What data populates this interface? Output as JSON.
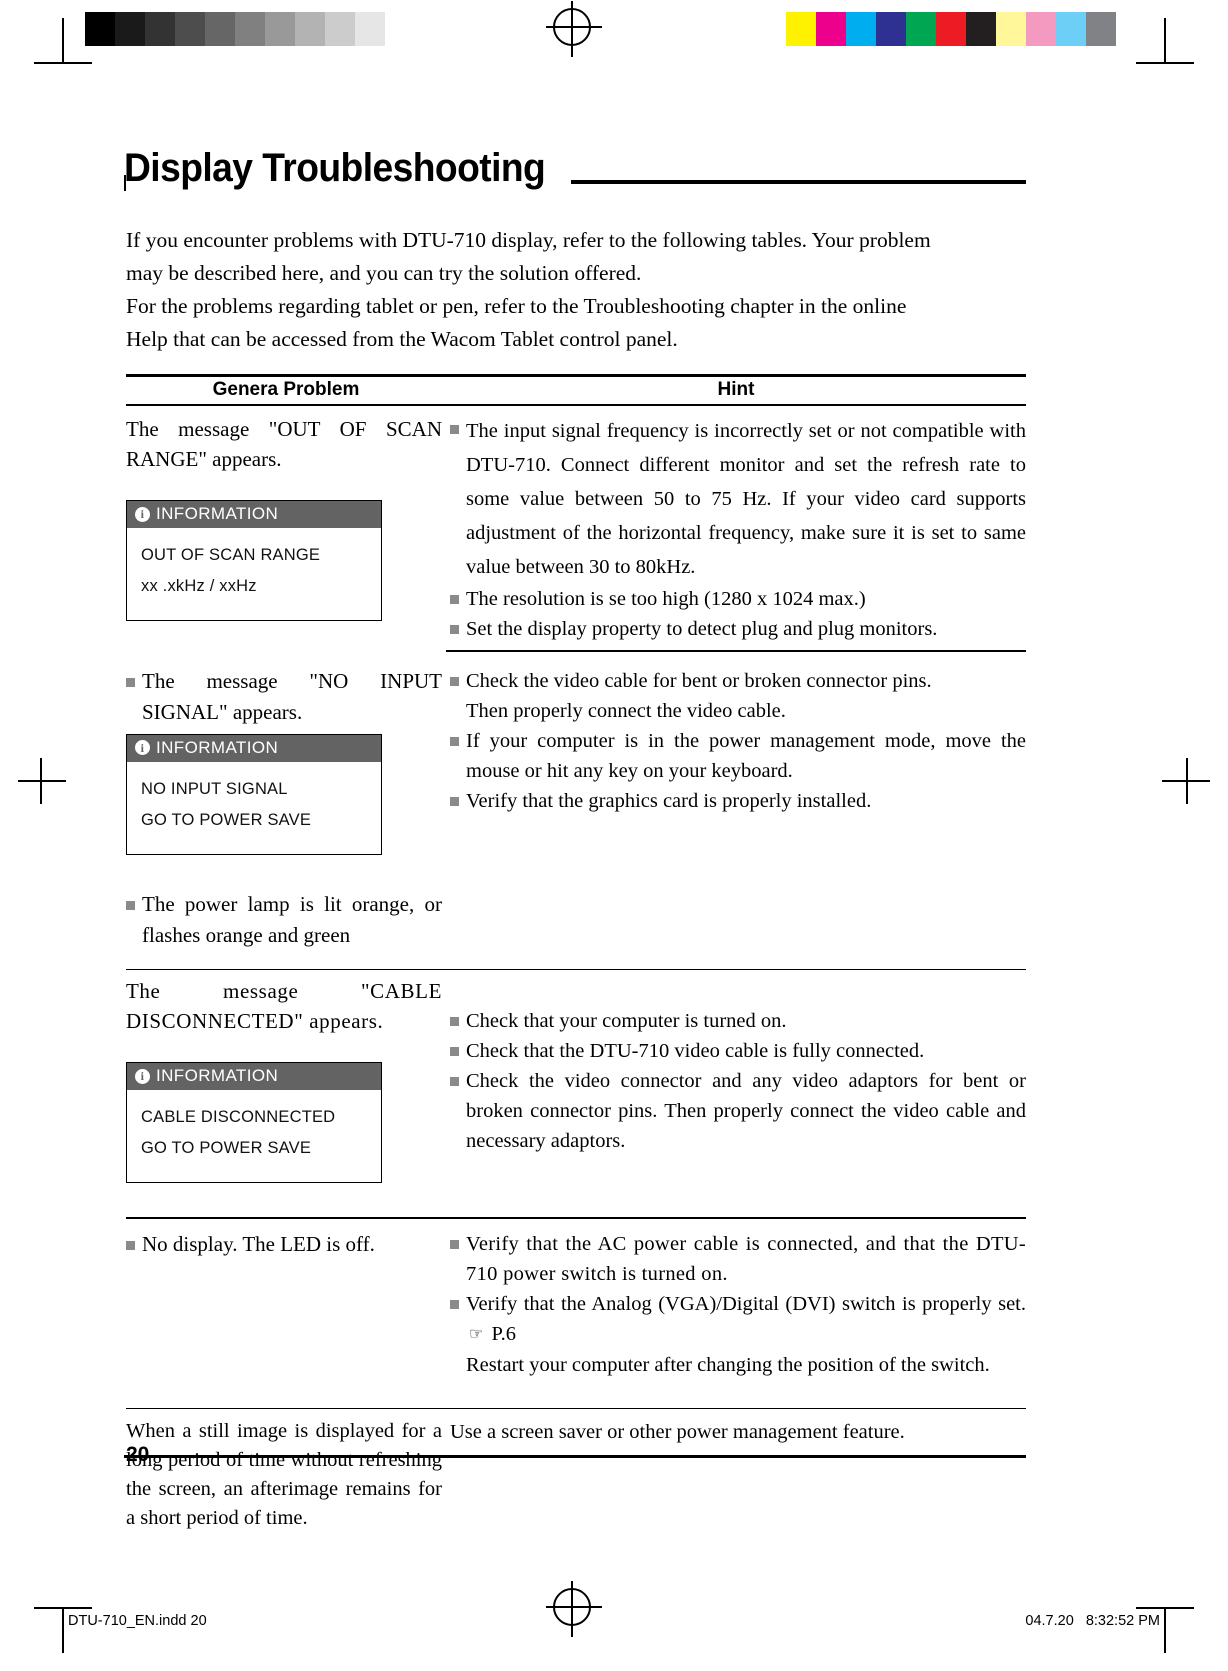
{
  "document": {
    "title": "Display Troubleshooting",
    "page_number": "20",
    "imprint_left": "DTU-710_EN.indd   20",
    "imprint_right": "04.7.20   8:32:52 PM"
  },
  "intro": {
    "line1": "If you encounter problems with DTU-710 display, refer to the following tables. Your problem",
    "line2": "may be described here, and you can try the solution offered.",
    "line3": "For the problems regarding tablet or pen, refer to the Troubleshooting chapter in the online",
    "line4": "Help that can be accessed from the Wacom Tablet control panel."
  },
  "table": {
    "headers": {
      "problem": "Genera Problem",
      "hint": "Hint"
    },
    "rows": [
      {
        "problem_text": "The message \"OUT OF SCAN RANGE\" appears.",
        "osd": {
          "header_label": "INFORMATION",
          "icon": "info-circle-icon",
          "line1": "OUT OF SCAN RANGE",
          "line2": "xx .xkHz /  xxHz"
        },
        "hints": [
          "The input signal frequency is incorrectly set or not compatible with DTU-710.  Connect different monitor and set the refresh rate to some value between 50 to 75 Hz.  If your video card supports adjustment of the horizontal frequency, make sure it is set to same value between 30 to 80kHz.",
          "The resolution is se too high (1280 x 1024 max.)",
          "Set the display property to detect plug and plug monitors."
        ]
      },
      {
        "problem_bullets": [
          "The message \"NO INPUT SIGNAL\" appears.",
          "The power lamp is lit orange, or flashes orange and green"
        ],
        "osd": {
          "header_label": "INFORMATION",
          "icon": "info-circle-icon",
          "line1": "NO INPUT SIGNAL",
          "line2": "GO TO POWER SAVE"
        },
        "hints": [
          "Check the video cable for bent or broken connector pins.",
          "Then properly connect the video cable.",
          "If your computer is in the power management mode, move the mouse or hit any key on your keyboard.",
          "Verify that the graphics card is properly installed."
        ]
      },
      {
        "problem_text": "The message \"CABLE DISCONNECTED\" appears.",
        "osd": {
          "header_label": "INFORMATION",
          "icon": "info-circle-icon",
          "line1": "CABLE DISCONNECTED",
          "line2": "GO TO POWER SAVE"
        },
        "hints": [
          "Check that your computer is turned on.",
          "Check that the DTU-710 video cable is fully connected.",
          "Check the video connector and any video adaptors for bent or broken connector pins.  Then properly connect the video cable and necessary adaptors."
        ]
      },
      {
        "problem_bullet": "No display.  The LED is off.",
        "hints": [
          "Verify that the AC power cable is connected, and that the DTU-710 power switch is turned on.",
          "Verify that the Analog (VGA)/Digital (DVI) switch is properly set.",
          "Restart your computer after changing the position of the switch."
        ],
        "page_ref": "P.6",
        "page_ref_icon": "pointing-hand-icon"
      },
      {
        "problem_text": "When a still image is displayed for a long period of time without refreshing the screen, an afterimage remains for a short period of time.",
        "hint_plain": "Use a screen saver or other power management feature."
      }
    ]
  },
  "print_marks": {
    "gray_bar": [
      "#000000",
      "#1a1a1a",
      "#333333",
      "#4d4d4d",
      "#666666",
      "#808080",
      "#999999",
      "#b3b3b3",
      "#cccccc",
      "#e6e6e6",
      "#ffffff"
    ],
    "color_bar": [
      "#ffffff",
      "#fff200",
      "#ec008c",
      "#00aeef",
      "#2e3192",
      "#00a651",
      "#ed1c24",
      "#231f20",
      "#fff799",
      "#f49ac1",
      "#6dcff6",
      "#808285"
    ]
  }
}
